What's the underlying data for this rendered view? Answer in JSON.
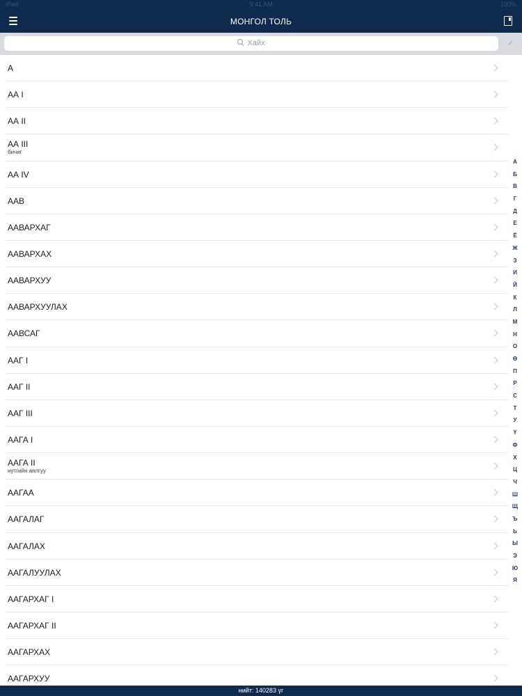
{
  "status_bar": {
    "carrier": "iPad",
    "time": "9:41 AM",
    "battery": "100%"
  },
  "nav": {
    "title": "МОНГОЛ ТОЛЬ",
    "menu_icon": "hamburger-menu-icon",
    "bookmark_icon": "bookmark-icon"
  },
  "search": {
    "placeholder": "Хайх",
    "confirm_label": "✓"
  },
  "words": [
    {
      "title": "А",
      "subtitle": ""
    },
    {
      "title": "АА I",
      "subtitle": ""
    },
    {
      "title": "АА II",
      "subtitle": ""
    },
    {
      "title": "АА III",
      "subtitle": "бичиг"
    },
    {
      "title": "АА IV",
      "subtitle": ""
    },
    {
      "title": "ААВ",
      "subtitle": ""
    },
    {
      "title": "ААВАРХАГ",
      "subtitle": ""
    },
    {
      "title": "ААВАРХАХ",
      "subtitle": ""
    },
    {
      "title": "ААВАРХУУ",
      "subtitle": ""
    },
    {
      "title": "ААВАРХУУЛАХ",
      "subtitle": ""
    },
    {
      "title": "ААВСАГ",
      "subtitle": ""
    },
    {
      "title": "ААГ I",
      "subtitle": ""
    },
    {
      "title": "ААГ II",
      "subtitle": ""
    },
    {
      "title": "ААГ III",
      "subtitle": ""
    },
    {
      "title": "ААГА I",
      "subtitle": ""
    },
    {
      "title": "ААГА II",
      "subtitle": "нутгийн аялгуу"
    },
    {
      "title": "ААГАА",
      "subtitle": ""
    },
    {
      "title": "ААГАЛАГ",
      "subtitle": ""
    },
    {
      "title": "ААГАЛАХ",
      "subtitle": ""
    },
    {
      "title": "ААГАЛУУЛАХ",
      "subtitle": ""
    },
    {
      "title": "ААГАРХАГ I",
      "subtitle": ""
    },
    {
      "title": "ААГАРХАГ II",
      "subtitle": ""
    },
    {
      "title": "ААГАРХАХ",
      "subtitle": ""
    },
    {
      "title": "ААГАРХУУ",
      "subtitle": ""
    }
  ],
  "alphabet_index": [
    "А",
    "Б",
    "В",
    "Г",
    "Д",
    "Е",
    "Ё",
    "Ж",
    "З",
    "И",
    "Й",
    "К",
    "Л",
    "М",
    "Н",
    "О",
    "Ө",
    "П",
    "Р",
    "С",
    "Т",
    "У",
    "Ү",
    "Ф",
    "Х",
    "Ц",
    "Ч",
    "Ш",
    "Щ",
    "Ъ",
    "Ь",
    "Ы",
    "Э",
    "Ю",
    "Я"
  ],
  "footer": {
    "count_text": "нийт: 140283 үг"
  },
  "colors": {
    "nav_background": "#0e2a4f",
    "search_background": "#d9dbe0",
    "index_letter": "#1f3a66",
    "separator": "#e7e8ea"
  }
}
